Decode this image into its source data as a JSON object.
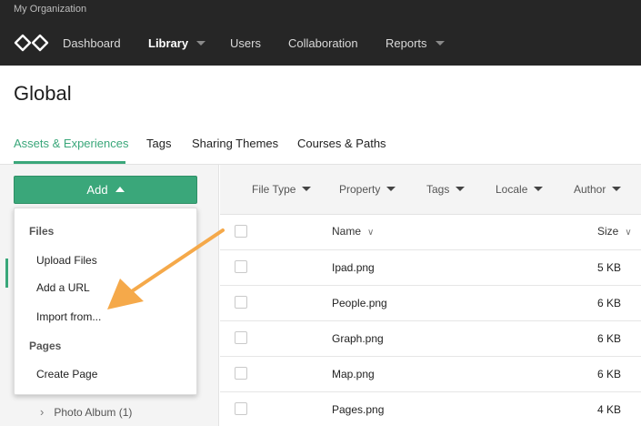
{
  "topbar": {
    "org_name": "My Organization",
    "logo_icon": "infinity-logo-icon",
    "nav": [
      {
        "label": "Dashboard",
        "active": false,
        "has_dropdown": false
      },
      {
        "label": "Library",
        "active": true,
        "has_dropdown": true
      },
      {
        "label": "Users",
        "active": false,
        "has_dropdown": false
      },
      {
        "label": "Collaboration",
        "active": false,
        "has_dropdown": false
      },
      {
        "label": "Reports",
        "active": false,
        "has_dropdown": true
      }
    ]
  },
  "page": {
    "title": "Global",
    "tabs": [
      {
        "label": "Assets & Experiences",
        "active": true
      },
      {
        "label": "Tags",
        "active": false
      },
      {
        "label": "Sharing Themes",
        "active": false
      },
      {
        "label": "Courses & Paths",
        "active": false
      }
    ]
  },
  "left_panel": {
    "add_label": "Add",
    "dropdown": {
      "files_header": "Files",
      "upload_files": "Upload Files",
      "add_url": "Add a URL",
      "import_from": "Import from...",
      "pages_header": "Pages",
      "create_page": "Create Page"
    },
    "tree_item": "Photo Album (1)"
  },
  "filters": [
    "File Type",
    "Property",
    "Tags",
    "Locale",
    "Author"
  ],
  "table": {
    "col_name": "Name",
    "col_size": "Size",
    "rows": [
      {
        "name": "Ipad.png",
        "size": "5 KB"
      },
      {
        "name": "People.png",
        "size": "6 KB"
      },
      {
        "name": "Graph.png",
        "size": "6 KB"
      },
      {
        "name": "Map.png",
        "size": "6 KB"
      },
      {
        "name": "Pages.png",
        "size": "4 KB"
      }
    ]
  },
  "colors": {
    "accent": "#3aa77a",
    "topbar": "#262626",
    "arrow": "#f5a94a"
  }
}
